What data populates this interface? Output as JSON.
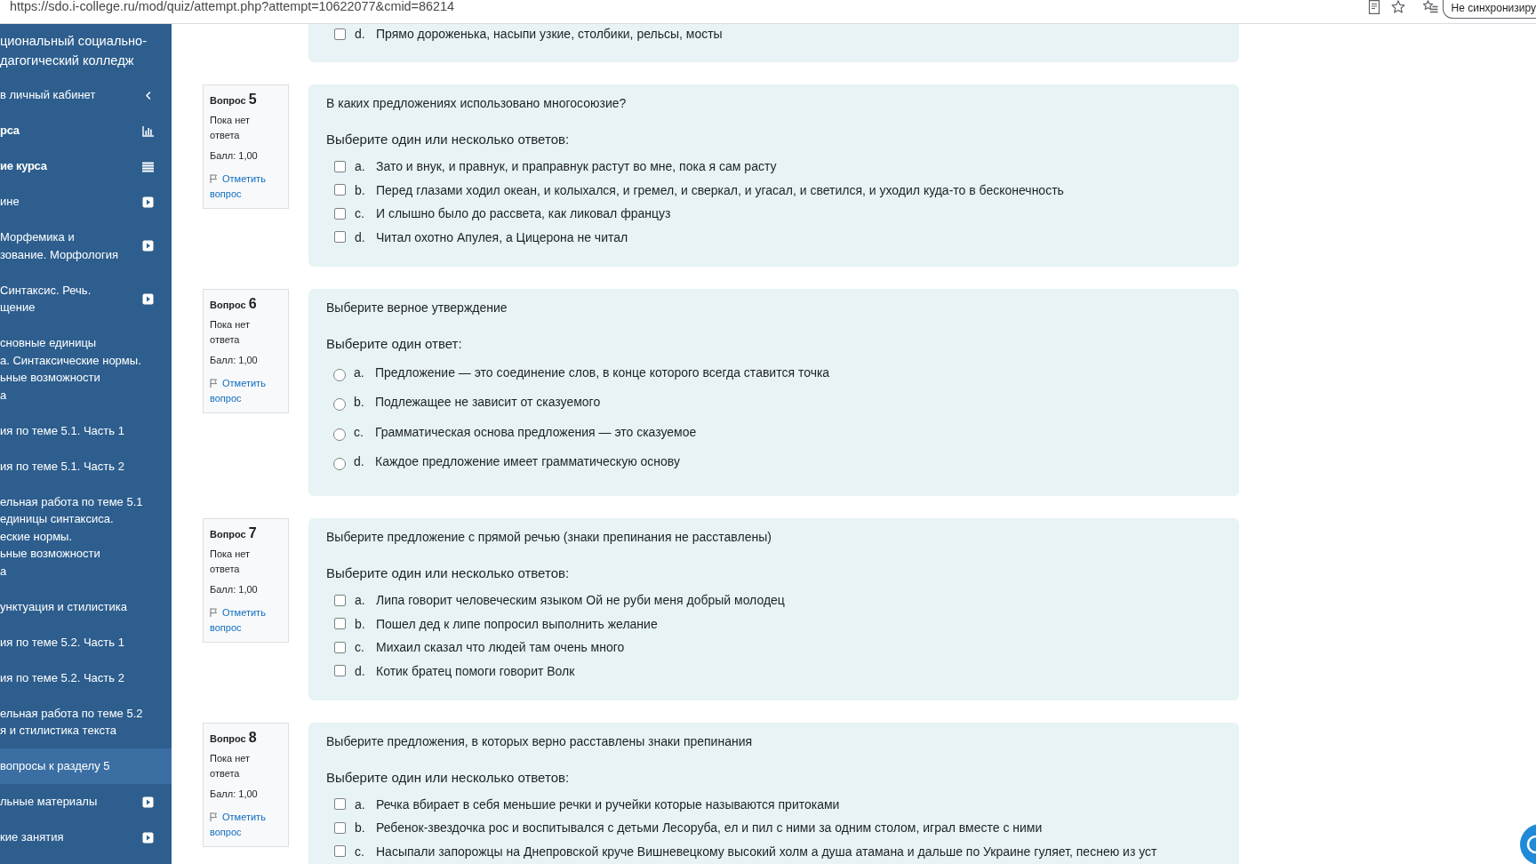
{
  "browser": {
    "url": "https://sdo.i-college.ru/mod/quiz/attempt.php?attempt=10622077&cmid=86214",
    "sync_label": "Не синхронизиру"
  },
  "sidebar": {
    "title_lines": [
      "циональный социально-",
      "дагогический колледж"
    ],
    "items": [
      {
        "kind": "back",
        "lines": [
          "в личный кабинет"
        ],
        "selected": false
      },
      {
        "kind": "report",
        "lines": [
          "рса"
        ],
        "selected": false
      },
      {
        "kind": "contents",
        "lines": [
          "ие курса"
        ],
        "selected": false
      },
      {
        "kind": "collapsed",
        "lines": [
          "ине"
        ],
        "selected": false
      },
      {
        "kind": "collapsed",
        "lines": [
          "Морфемика и",
          "зование. Морфология"
        ],
        "selected": false
      },
      {
        "kind": "collapsed",
        "lines": [
          "Синтаксис. Речь.",
          "щение"
        ],
        "selected": false
      },
      {
        "kind": "plain",
        "lines": [
          "сновные единицы",
          "а. Синтаксические нормы.",
          "ьные возможности",
          "а"
        ],
        "selected": false
      },
      {
        "kind": "plain",
        "lines": [
          "ия по теме 5.1. Часть 1"
        ],
        "selected": false
      },
      {
        "kind": "plain",
        "lines": [
          "ия по теме 5.1. Часть 2"
        ],
        "selected": false
      },
      {
        "kind": "plain",
        "lines": [
          "ельная работа по теме 5.1",
          "единицы синтаксиса.",
          "еские нормы.",
          "ьные возможности",
          "а"
        ],
        "selected": false
      },
      {
        "kind": "plain",
        "lines": [
          "унктуация и стилистика"
        ],
        "selected": false
      },
      {
        "kind": "plain",
        "lines": [
          "ия по теме 5.2. Часть 1"
        ],
        "selected": false
      },
      {
        "kind": "plain",
        "lines": [
          "ия по теме 5.2. Часть 2"
        ],
        "selected": false
      },
      {
        "kind": "plain",
        "lines": [
          "ельная работа по теме 5.2",
          "я и стилистика текста"
        ],
        "selected": false
      },
      {
        "kind": "plain",
        "lines": [
          "вопросы к разделу 5"
        ],
        "selected": true
      },
      {
        "kind": "collapsed",
        "lines": [
          "льные материалы"
        ],
        "selected": false
      },
      {
        "kind": "collapsed",
        "lines": [
          "кие занятия"
        ],
        "selected": false
      }
    ]
  },
  "quiz": {
    "partial_question": {
      "kind": "multi",
      "options": [
        {
          "letter": "d.",
          "text": "Прямо дороженька, насыпи узкие, столбики, рельсы, мосты",
          "checked": false
        }
      ]
    },
    "questions": [
      {
        "label": "Вопрос",
        "number": "5",
        "status": "Пока нет ответа",
        "grade": "Балл: 1,00",
        "flag_link": "Отметить вопрос",
        "text": "В каких предложениях использовано многосоюзие?",
        "prompt": "Выберите один или несколько ответов:",
        "kind": "multi",
        "options": [
          {
            "letter": "a.",
            "text": "Зато и внук, и правнук, и праправнук растут во мне, пока я сам расту",
            "checked": false
          },
          {
            "letter": "b.",
            "text": "Перед глазами ходил океан, и колыхался, и гремел, и сверкал, и угасал, и светился, и уходил куда-то в бесконечность",
            "checked": false
          },
          {
            "letter": "c.",
            "text": "И слышно было до рассвета, как ликовал француз",
            "checked": false
          },
          {
            "letter": "d.",
            "text": "Читал охотно Апулея, а Цицерона не читал",
            "checked": false
          }
        ]
      },
      {
        "label": "Вопрос",
        "number": "6",
        "status": "Пока нет ответа",
        "grade": "Балл: 1,00",
        "flag_link": "Отметить вопрос",
        "text": "Выберите верное утверждение",
        "prompt": "Выберите один ответ:",
        "kind": "single",
        "options": [
          {
            "letter": "a.",
            "text": "Предложение — это соединение слов, в конце которого всегда ставится точка",
            "selected": false
          },
          {
            "letter": "b.",
            "text": "Подлежащее не зависит от сказуемого",
            "selected": false
          },
          {
            "letter": "c.",
            "text": "Грамматическая основа предложения — это сказуемое",
            "selected": false
          },
          {
            "letter": "d.",
            "text": "Каждое предложение имеет грамматическую основу",
            "selected": false
          }
        ]
      },
      {
        "label": "Вопрос",
        "number": "7",
        "status": "Пока нет ответа",
        "grade": "Балл: 1,00",
        "flag_link": "Отметить вопрос",
        "text": "Выберите предложение с прямой речью (знаки препинания не расставлены)",
        "prompt": "Выберите один или несколько ответов:",
        "kind": "multi",
        "options": [
          {
            "letter": "a.",
            "text": "Липа говорит человеческим языком Ой не руби меня добрый молодец",
            "checked": false
          },
          {
            "letter": "b.",
            "text": "Пошел дед к липе попросил выполнить желание",
            "checked": false
          },
          {
            "letter": "c.",
            "text": "Михаил сказал что людей там очень много",
            "checked": false
          },
          {
            "letter": "d.",
            "text": "Котик братец помоги говорит Волк",
            "checked": false
          }
        ]
      },
      {
        "label": "Вопрос",
        "number": "8",
        "status": "Пока нет ответа",
        "grade": "Балл: 1,00",
        "flag_link": "Отметить вопрос",
        "text": "Выберите предложения, в которых верно расставлены знаки препинания",
        "prompt": "Выберите один или несколько ответов:",
        "kind": "multi",
        "options": [
          {
            "letter": "a.",
            "text": "Речка вбирает в себя меньшие речки и ручейки которые называются притоками",
            "checked": false
          },
          {
            "letter": "b.",
            "text": "Ребенок-звездочка рос и воспитывался с детьми Лесоруба, ел и пил с ними за одним столом, играл вместе с ними",
            "checked": false
          },
          {
            "letter": "c.",
            "text": "Насыпали запорожцы на Днепровской круче Вишневецкому высокий холм а душа атамана и дальше по Украине гуляет, песнею из уст",
            "checked": false
          }
        ]
      }
    ]
  }
}
